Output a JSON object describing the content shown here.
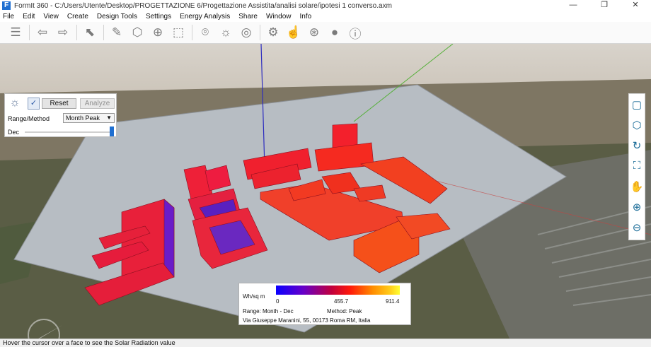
{
  "window": {
    "title": "FormIt 360 - C:/Users/Utente/Desktop/PROGETTAZIONE 6/Progettazione Assistita/analisi solare/ipotesi 1 converso.axm",
    "app_logo": "F",
    "minimize": "—",
    "maximize": "❐",
    "close": "✕"
  },
  "menu": {
    "items": [
      "File",
      "Edit",
      "View",
      "Create",
      "Design Tools",
      "Settings",
      "Energy Analysis",
      "Share",
      "Window",
      "Info"
    ]
  },
  "toolbar": {
    "icons": [
      "layers-icon",
      "undo-icon",
      "redo-icon",
      "select-icon",
      "draw-icon",
      "cube-icon",
      "add-group-icon",
      "group-icon",
      "location-icon",
      "sun-icon",
      "energy-icon",
      "settings-icon",
      "hand-icon",
      "share-icon",
      "user-icon",
      "info-icon"
    ]
  },
  "solar_panel": {
    "reset_label": "Reset",
    "analyze_label": "Analyze",
    "range_label": "Range/Method",
    "method_value": "Month Peak",
    "month_label": "Dec"
  },
  "view_tools": {
    "icons": [
      "zoom-extents-icon",
      "view-cube-icon",
      "orbit-icon",
      "walk-icon",
      "pan-icon",
      "zoom-in-icon",
      "zoom-out-icon"
    ]
  },
  "legend": {
    "unit": "Wh/sq m",
    "min": "0",
    "mid": "455.7",
    "max": "911.4",
    "range": "Range: Month - Dec",
    "method": "Method: Peak",
    "address": "Via Giuseppe Maranini, 55, 00173 Roma RM, Italia"
  },
  "status": {
    "text": "Hover the cursor over a face to see the Solar Radiation value"
  }
}
